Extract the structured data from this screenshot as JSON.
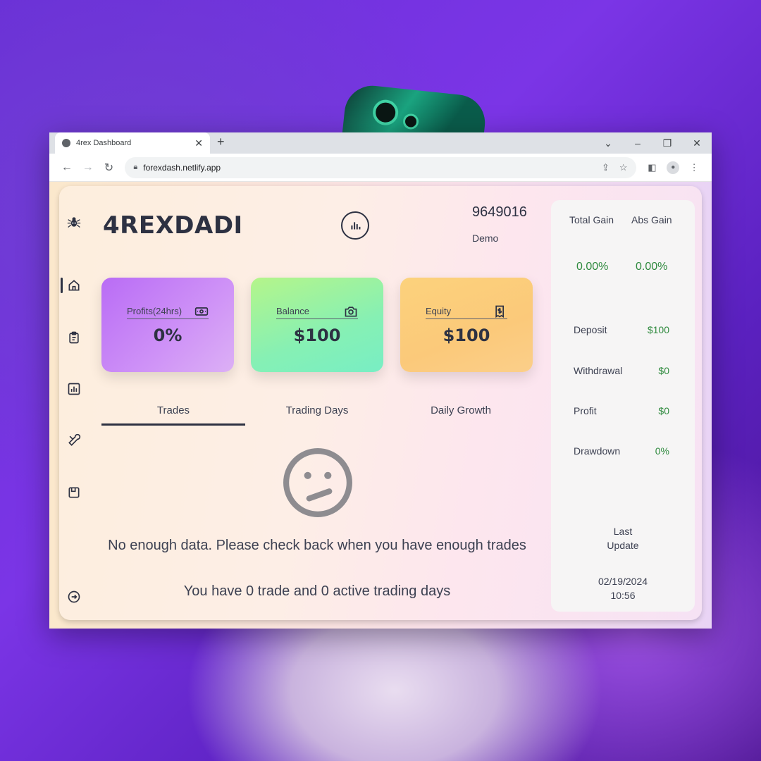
{
  "browser": {
    "tab_title": "4rex Dashboard",
    "new_tab": "+",
    "url": "forexdash.netlify.app",
    "window_controls": [
      "⌄",
      "–",
      "❐",
      "✕"
    ]
  },
  "app": {
    "brand": "4REXDADI",
    "account_number": "9649016",
    "account_type": "Demo"
  },
  "stats": [
    {
      "label": "Profits(24hrs)",
      "value": "0%",
      "icon": "cash-icon"
    },
    {
      "label": "Balance",
      "value": "$100",
      "icon": "camera-icon"
    },
    {
      "label": "Equity",
      "value": "$100",
      "icon": "receipt-dollar-icon"
    }
  ],
  "tabs": [
    "Trades",
    "Trading Days",
    "Daily Growth"
  ],
  "empty_state": {
    "message": "No enough data. Please check back when you have enough trades",
    "summary": "You have 0 trade and 0 active trading days"
  },
  "summary_panel": {
    "total_gain_label": "Total Gain",
    "abs_gain_label": "Abs Gain",
    "total_gain": "0.00%",
    "abs_gain": "0.00%",
    "rows": [
      {
        "label": "Deposit",
        "value": "$100"
      },
      {
        "label": "Withdrawal",
        "value": "$0"
      },
      {
        "label": "Profit",
        "value": "$0"
      },
      {
        "label": "Drawdown",
        "value": "0%"
      }
    ],
    "last_update_label_1": "Last",
    "last_update_label_2": "Update",
    "last_update_date": "02/19/2024",
    "last_update_time": "10:56"
  },
  "colors": {
    "accent": "#2d3142",
    "positive": "#2f8a3e"
  }
}
